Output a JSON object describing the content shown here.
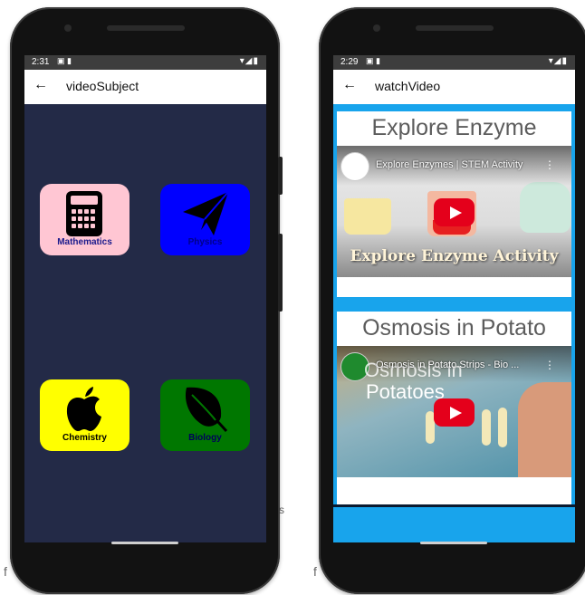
{
  "phone1": {
    "status": {
      "time": "2:31",
      "icons_left": "▣ ▮",
      "icons_right": "▾◢▮"
    },
    "appbar": {
      "back": "←",
      "title": "videoSubject"
    },
    "subjects": [
      {
        "label": "Mathematics",
        "icon": "calculator-icon",
        "bg": "#ffc6d3",
        "fg": "#1a1a8c"
      },
      {
        "label": "Physics",
        "icon": "paper-plane-icon",
        "bg": "#0000ff",
        "fg": "#00008a"
      },
      {
        "label": "Chemistry",
        "icon": "apple-icon",
        "bg": "#ffff00",
        "fg": "#000000"
      },
      {
        "label": "Biology",
        "icon": "leaf-icon",
        "bg": "#007700",
        "fg": "#00005a"
      }
    ],
    "background": "#232a47"
  },
  "phone2": {
    "status": {
      "time": "2:29",
      "icons_left": "▣ ▮",
      "icons_right": "▾◢▮"
    },
    "appbar": {
      "back": "←",
      "title": "watchVideo"
    },
    "videos": [
      {
        "heading": "Explore Enzyme",
        "video_title": "Explore Enzymes | STEM Activity",
        "overlay": "Explore Enzyme Activity",
        "menu": "⋮",
        "play_icon": "youtube-play-icon"
      },
      {
        "heading": "Osmosis in Potato",
        "video_title": "Osmosis in Potato Strips - Bio ...",
        "overlay_line1": "Osmosis in",
        "overlay_line2": "Potatoes",
        "menu": "⋮",
        "play_icon": "youtube-play-icon"
      }
    ],
    "accent": "#18a4ec"
  },
  "background_text": {
    "left": "f",
    "right": "f",
    "mid": "s"
  }
}
